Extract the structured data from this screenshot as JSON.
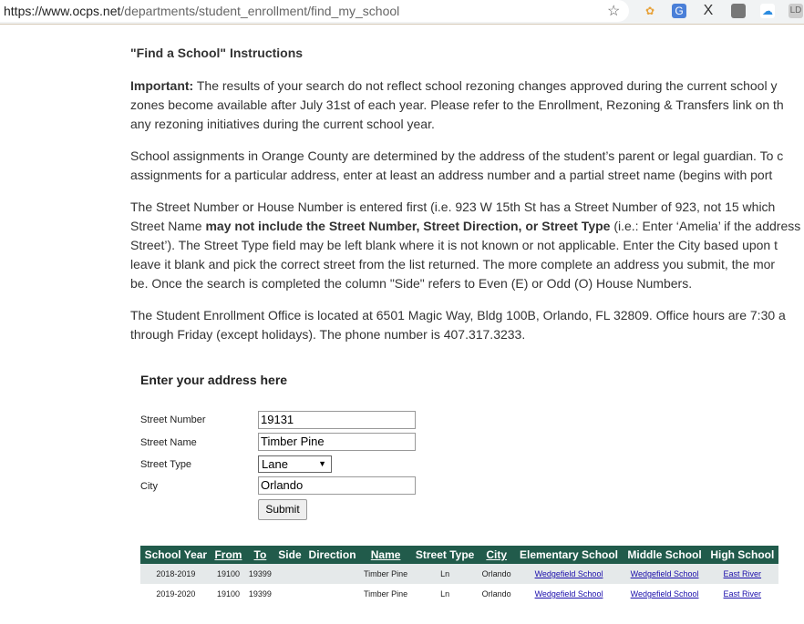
{
  "browser": {
    "url_host": "https://www.ocps.net",
    "url_path": "/departments/student_enrollment/find_my_school",
    "extensions": [
      "puzzle",
      "G",
      "X",
      "img",
      "cloud",
      "LD"
    ]
  },
  "instructions": {
    "title": "\"Find a School\" Instructions",
    "p1": [
      [
        {
          "b": "Important:"
        },
        {
          "t": " The results of your search do not reflect school rezoning changes approved during the current school y"
        }
      ],
      [
        {
          "t": "zones become available after July 31st of each year. Please refer to the Enrollment, Rezoning & Transfers link on th"
        }
      ],
      [
        {
          "t": "any rezoning initiatives during the current school year."
        }
      ]
    ],
    "p2": [
      [
        {
          "t": "School assignments in Orange County are determined by the address of the student’s parent or legal guardian. To c"
        }
      ],
      [
        {
          "t": "assignments for a particular address, enter at least an address number and a partial street name (begins with port"
        }
      ]
    ],
    "p3": [
      [
        {
          "t": "The Street Number or House Number is entered first (i.e. 923 W 15th St has a Street Number of 923, not 15 which"
        }
      ],
      [
        {
          "t": "Street Name "
        },
        {
          "b": "may not include the Street Number, Street Direction, or Street Type"
        },
        {
          "t": " (i.e.: Enter ‘Amelia’ if the address"
        }
      ],
      [
        {
          "t": "Street’). The Street Type field may be left blank where it is not known or not applicable. Enter the City based upon t"
        }
      ],
      [
        {
          "t": "leave it blank and pick the correct street from the list returned. The more complete an address you submit, the mor"
        }
      ],
      [
        {
          "t": "be. Once the search is completed the column \"Side\" refers to Even (E) or Odd (O) House Numbers."
        }
      ]
    ],
    "p4": [
      [
        {
          "t": "The Student Enrollment Office is located at 6501 Magic Way, Bldg 100B, Orlando, FL 32809. Office hours are 7:30 a"
        }
      ],
      [
        {
          "t": "through Friday (except holidays). The phone number is 407.317.3233."
        }
      ]
    ]
  },
  "form": {
    "title": "Enter your address here",
    "street_number_label": "Street Number",
    "street_number": "19131",
    "street_name_label": "Street Name",
    "street_name": "Timber Pine",
    "street_type_label": "Street Type",
    "street_type": "Lane",
    "city_label": "City",
    "city": "Orlando",
    "submit": "Submit"
  },
  "results": {
    "headers": [
      {
        "l": "School Year",
        "u": false
      },
      {
        "l": "From",
        "u": true
      },
      {
        "l": "To",
        "u": true
      },
      {
        "l": "Side",
        "u": false
      },
      {
        "l": "Direction",
        "u": false
      },
      {
        "l": "Name",
        "u": true
      },
      {
        "l": "Street Type",
        "u": false
      },
      {
        "l": "City",
        "u": true
      },
      {
        "l": "Elementary School",
        "u": false
      },
      {
        "l": "Middle School",
        "u": false
      },
      {
        "l": "High School",
        "u": false
      }
    ],
    "rows": [
      [
        "2018-2019",
        "19100",
        "19399",
        "",
        "",
        "Timber Pine",
        "Ln",
        "Orlando",
        "Wedgefield School",
        "Wedgefield School",
        "East River"
      ],
      [
        "2019-2020",
        "19100",
        "19399",
        "",
        "",
        "Timber Pine",
        "Ln",
        "Orlando",
        "Wedgefield School",
        "Wedgefield School",
        "East River"
      ]
    ]
  },
  "colors": {
    "header_bg": "#215b4b",
    "link": "#1a0dab"
  }
}
